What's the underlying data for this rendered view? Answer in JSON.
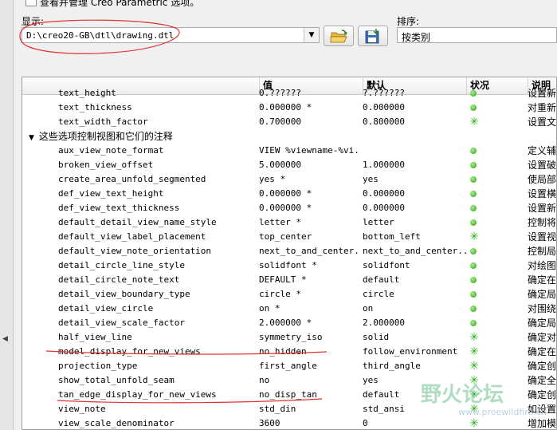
{
  "options_checkbox": {
    "label": "查看并管理 Creo Parametric 选项。"
  },
  "show": {
    "label": "显示:",
    "value": "D:\\creo20-GB\\dtl\\drawing.dtl"
  },
  "sort": {
    "label": "排序:",
    "value": "按类别"
  },
  "columns": {
    "name": "",
    "value": "值",
    "default": "默认",
    "status": "状况",
    "description": "说明"
  },
  "rows": [
    {
      "name": "text_height",
      "value": "0.??????",
      "default": "?.??????",
      "status": "dot",
      "desc": "设置新"
    },
    {
      "name": "text_thickness",
      "value": "0.000000 *",
      "default": "0.000000",
      "status": "dot",
      "desc": "对重新"
    },
    {
      "name": "text_width_factor",
      "value": "0.700000",
      "default": "0.800000",
      "status": "star",
      "desc": "设置文"
    },
    {
      "group": "这些选项控制视图和它们的注释"
    },
    {
      "name": "aux_view_note_format",
      "value": "VIEW %viewname-%vi...",
      "default": "",
      "status": "dot",
      "desc": "定义辅"
    },
    {
      "name": "broken_view_offset",
      "value": "5.000000",
      "default": "1.000000",
      "status": "dot",
      "desc": "设置破"
    },
    {
      "name": "create_area_unfold_segmented",
      "value": "yes *",
      "default": "yes",
      "status": "dot",
      "desc": "使局部"
    },
    {
      "name": "def_view_text_height",
      "value": "0.000000 *",
      "default": "0.000000",
      "status": "dot",
      "desc": "设置横"
    },
    {
      "name": "def_view_text_thickness",
      "value": "0.000000 *",
      "default": "0.000000",
      "status": "dot",
      "desc": "设置新"
    },
    {
      "name": "default_detail_view_name_style",
      "value": "letter *",
      "default": "letter",
      "status": "dot",
      "desc": "控制将"
    },
    {
      "name": "default_view_label_placement",
      "value": "top_center",
      "default": "bottom_left",
      "status": "star",
      "desc": "设置视"
    },
    {
      "name": "default_view_note_orientation",
      "value": "next_to_and_center...",
      "default": "next_to_and_center...",
      "status": "dot",
      "desc": "控制局"
    },
    {
      "name": "detail_circle_line_style",
      "value": "solidfont *",
      "default": "solidfont",
      "status": "dot",
      "desc": "对绘图"
    },
    {
      "name": "detail_circle_note_text",
      "value": "DEFAULT *",
      "default": "default",
      "status": "dot",
      "desc": "确定在"
    },
    {
      "name": "detail_view_boundary_type",
      "value": "circle *",
      "default": "circle",
      "status": "dot",
      "desc": "确定局"
    },
    {
      "name": "detail_view_circle",
      "value": "on *",
      "default": "on",
      "status": "dot",
      "desc": "对围绕"
    },
    {
      "name": "detail_view_scale_factor",
      "value": "2.000000 *",
      "default": "2.000000",
      "status": "dot",
      "desc": "确定局"
    },
    {
      "name": "half_view_line",
      "value": "symmetry_iso",
      "default": "solid",
      "status": "star",
      "desc": "确定对"
    },
    {
      "name": "model_display_for_new_views",
      "value": "no_hidden",
      "default": "follow_environment",
      "status": "star",
      "desc": "确定在"
    },
    {
      "name": "projection_type",
      "value": "first_angle",
      "default": "third_angle",
      "status": "star",
      "desc": "确定创"
    },
    {
      "name": "show_total_unfold_seam",
      "value": "no",
      "default": "yes",
      "status": "star",
      "desc": "确定全"
    },
    {
      "name": "tan_edge_display_for_new_views",
      "value": "no_disp_tan",
      "default": "default",
      "status": "star",
      "desc": "确定创"
    },
    {
      "name": "view_note",
      "value": "std_din",
      "default": "std_ansi",
      "status": "star",
      "desc": "如设置"
    },
    {
      "name": "view_scale_denominator",
      "value": "3600",
      "default": "0",
      "status": "star",
      "desc": "增加模"
    }
  ],
  "watermark": {
    "text": "野火论坛",
    "sub": "www.proewildfire.cn"
  },
  "colors": {
    "annotation": "#e23030",
    "status_green": "#2e9c19"
  }
}
